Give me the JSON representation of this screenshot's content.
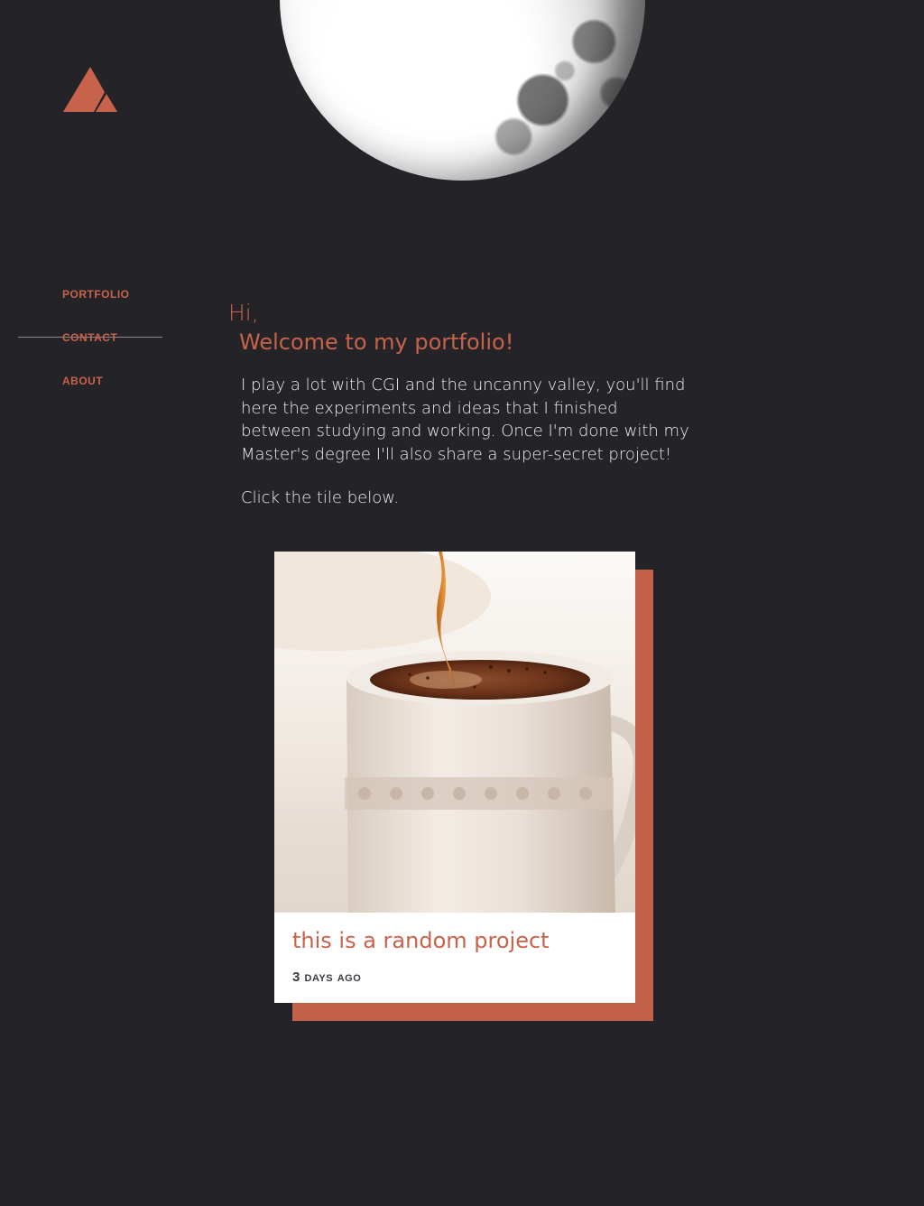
{
  "brand": {
    "logo_icon": "triangle-mountain-logo",
    "accent_color": "#c8634b"
  },
  "nav": {
    "items": [
      {
        "label": "PORTFOLIO"
      },
      {
        "label": "CONTACT"
      },
      {
        "label": "ABOUT"
      }
    ]
  },
  "intro": {
    "greeting": "Hi,",
    "headline": "Welcome to my portfolio!",
    "body": "I play a lot with CGI and the uncanny valley, you'll find here the experiments and ideas that I finished between studying and working. Once I'm done with my Master's degree I'll also share a super-secret project!",
    "cta": "Click the tile below."
  },
  "tile": {
    "title": "this is a random project",
    "meta": "3 days ago",
    "image_icon": "coffee-cup-image",
    "shadow_color": "#c2604a"
  },
  "hero": {
    "image_icon": "moon-image"
  }
}
